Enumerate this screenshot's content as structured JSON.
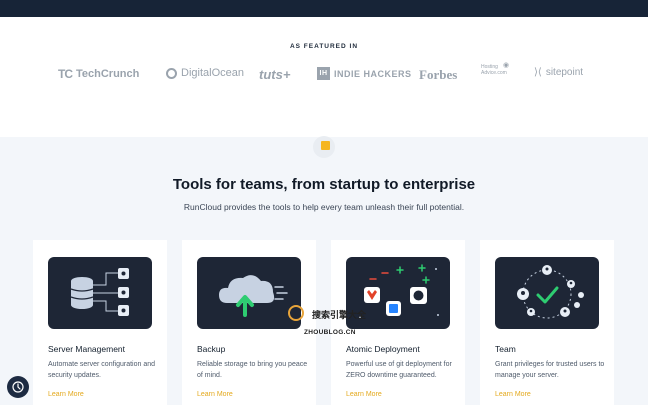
{
  "featured": {
    "title": "AS FEATURED IN",
    "logos": {
      "techcrunch": "TechCrunch",
      "techcrunch_mark": "TC",
      "digitalocean": "DigitalOcean",
      "tuts": "tuts+",
      "indiehackers": "INDIE HACKERS",
      "indiehackers_mark": "IH",
      "forbes": "Forbes",
      "hostingadvice_line1": "Hosting",
      "hostingadvice_line2": "Advice.com",
      "sitepoint": "sitepoint"
    }
  },
  "hero": {
    "headline": "Tools for teams, from startup to enterprise",
    "subline": "RunCloud provides the tools to help every team unleash their full potential."
  },
  "features": [
    {
      "title": "Server Management",
      "desc": "Automate server configuration and security updates.",
      "link": "Learn More"
    },
    {
      "title": "Backup",
      "desc": "Reliable storage to bring you peace of mind.",
      "link": "Learn More"
    },
    {
      "title": "Atomic Deployment",
      "desc": "Powerful use of git deployment for ZERO downtime guaranteed.",
      "link": "Learn More"
    },
    {
      "title": "Team",
      "desc": "Grant privileges for trusted users to manage your server.",
      "link": "Learn More"
    }
  ],
  "watermark": {
    "brand": "搜索引擎大全",
    "url": "ZHOUBLOG.CN"
  },
  "colors": {
    "nav_bg": "#172437",
    "accent": "#f5b622",
    "card_illustration_bg": "#1e2636",
    "link": "#e4a91d"
  }
}
